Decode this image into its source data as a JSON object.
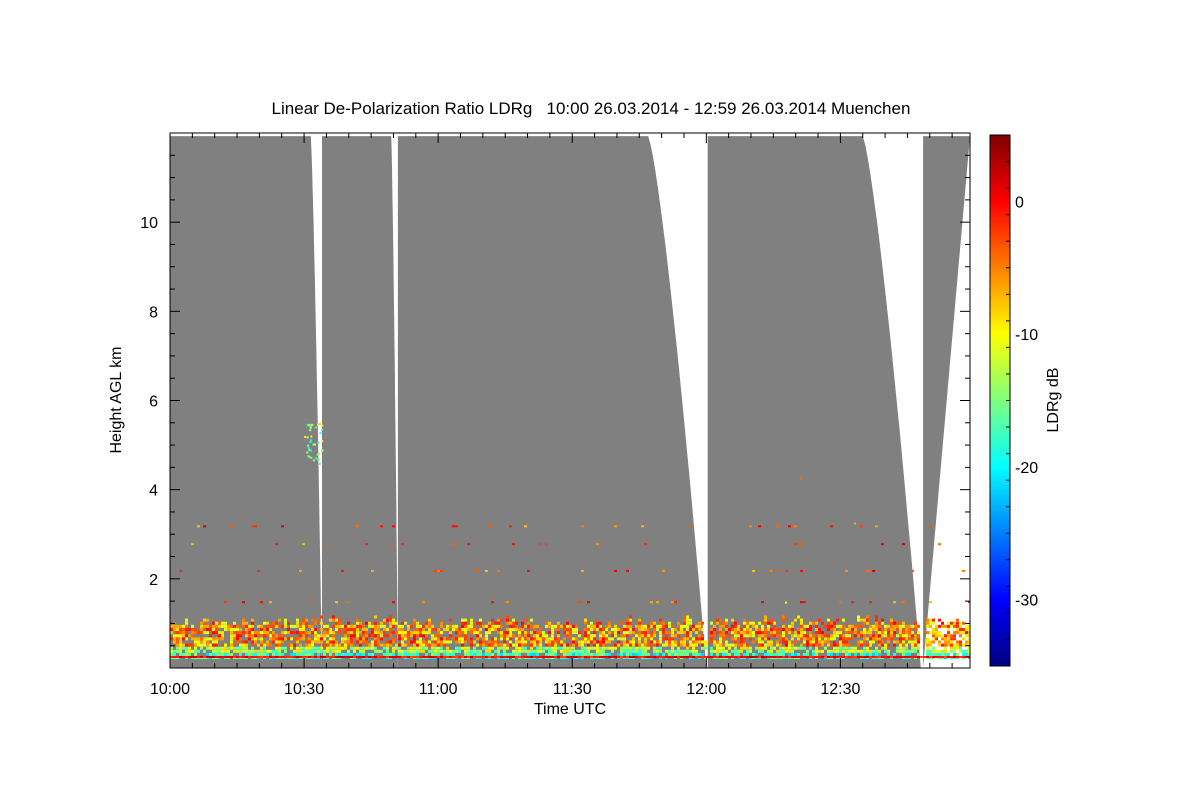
{
  "chart_data": {
    "type": "heatmap",
    "title": "Linear De-Polarization Ratio LDRg   10:00 26.03.2014 - 12:59 26.03.2014 Muenchen",
    "xlabel": "Time UTC",
    "ylabel": "Height AGL km",
    "colorbar_label": "LDRg dB",
    "xlim_minutes": [
      0,
      179
    ],
    "ylim": [
      0,
      12
    ],
    "x_ticks": [
      {
        "minutes": 0,
        "label": "10:00"
      },
      {
        "minutes": 30,
        "label": "10:30"
      },
      {
        "minutes": 60,
        "label": "11:00"
      },
      {
        "minutes": 90,
        "label": "11:30"
      },
      {
        "minutes": 120,
        "label": "12:00"
      },
      {
        "minutes": 150,
        "label": "12:30"
      }
    ],
    "y_ticks": [
      {
        "value": 2,
        "label": "2"
      },
      {
        "value": 4,
        "label": "4"
      },
      {
        "value": 6,
        "label": "6"
      },
      {
        "value": 8,
        "label": "8"
      },
      {
        "value": 10,
        "label": "10"
      }
    ],
    "colorbar": {
      "range": [
        -35,
        5
      ],
      "ticks": [
        {
          "value": 0,
          "label": "0"
        },
        {
          "value": -10,
          "label": "-10"
        },
        {
          "value": -20,
          "label": "-20"
        },
        {
          "value": -30,
          "label": "-30"
        }
      ],
      "colormap": [
        "#00007f",
        "#0000ff",
        "#007fff",
        "#00ffff",
        "#7fff7f",
        "#ffff00",
        "#ff7f00",
        "#ff0000",
        "#7f0000"
      ]
    },
    "background_color": "#808080",
    "scans": [
      {
        "t_start": 0,
        "t_end": 31.5,
        "ground_end": 34.0
      },
      {
        "t_start": 34.0,
        "t_end": 49.5,
        "ground_end": 51.0
      },
      {
        "t_start": 51.0,
        "t_end": 107.0,
        "ground_end": 120.0
      },
      {
        "t_start": 120.3,
        "t_end": 155.0,
        "ground_end": 168.0
      },
      {
        "t_start": 168.5,
        "t_end": 179.0,
        "ground_end": 179.0
      }
    ],
    "boundary_layer_top_km": 0.9,
    "elevated_layers_km": [
      1.5,
      2.2,
      2.8,
      3.2
    ]
  }
}
